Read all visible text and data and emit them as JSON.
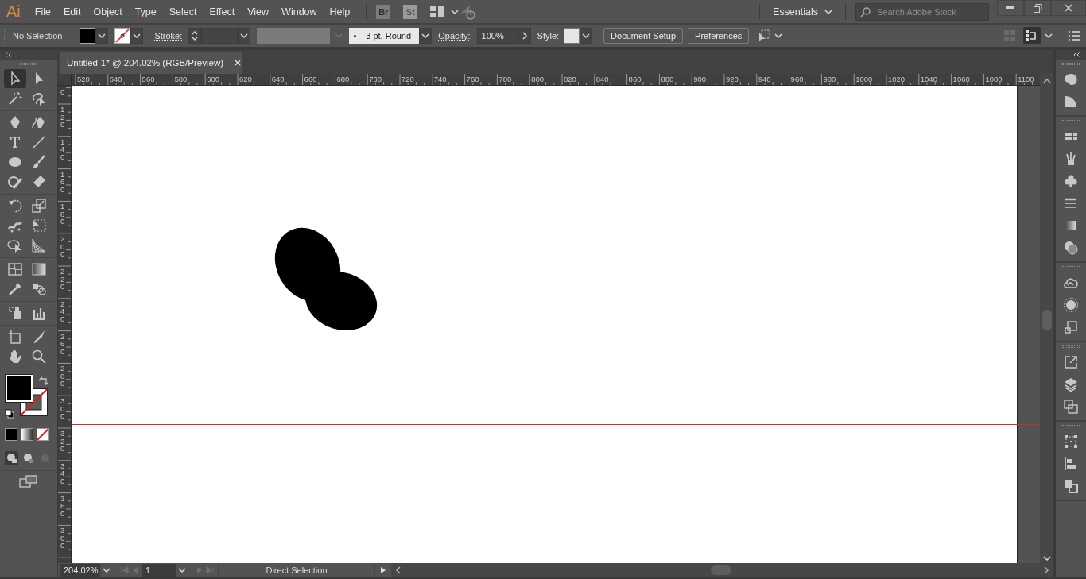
{
  "logo": "Ai",
  "menu": [
    "File",
    "Edit",
    "Object",
    "Type",
    "Select",
    "Effect",
    "View",
    "Window",
    "Help"
  ],
  "bridge": "Br",
  "stock": "St",
  "workspace": "Essentials",
  "search": {
    "placeholder": "Search Adobe Stock"
  },
  "control_bar": {
    "selection": "No Selection",
    "stroke_label": "Stroke:",
    "brush": "3 pt. Round",
    "opacity_label": "Opacity:",
    "opacity": "100%",
    "style_label": "Style:",
    "buttons": [
      "Document Setup",
      "Preferences"
    ]
  },
  "document_tab": {
    "title": "Untitled-1* @ 204.02% (RGB/Preview)"
  },
  "horizontal_ruler": [
    "520",
    "540",
    "560",
    "580",
    "600",
    "620",
    "640",
    "660",
    "680",
    "700",
    "720",
    "740",
    "760",
    "780",
    "800",
    "820",
    "840",
    "860",
    "880",
    "900",
    "920",
    "940",
    "960",
    "980",
    "1000",
    "1020",
    "1040",
    "1060",
    "1080",
    "1100"
  ],
  "vertical_ruler": [
    "0",
    "120",
    "140",
    "160",
    "180",
    "200",
    "220",
    "240",
    "260",
    "280",
    "300",
    "320",
    "340",
    "360",
    "380"
  ],
  "tool_groups": [
    {
      "tools": [
        {
          "kind": "selection",
          "selected": true
        },
        {
          "kind": "direct",
          "selected": false
        },
        {
          "kind": "wand",
          "selected": false
        },
        {
          "kind": "lasso",
          "selected": false
        }
      ]
    },
    {
      "tools": [
        {
          "kind": "pen",
          "selected": false
        },
        {
          "kind": "curvature",
          "selected": false
        },
        {
          "kind": "type",
          "selected": false
        },
        {
          "kind": "line",
          "selected": false
        },
        {
          "kind": "ellipse",
          "selected": false
        },
        {
          "kind": "brush",
          "selected": false
        },
        {
          "kind": "shaper",
          "selected": false
        },
        {
          "kind": "eraser",
          "selected": false
        }
      ]
    },
    {
      "tools": [
        {
          "kind": "rotate",
          "selected": false
        },
        {
          "kind": "scale",
          "selected": false
        },
        {
          "kind": "warp",
          "selected": false
        },
        {
          "kind": "freetransform",
          "selected": false
        },
        {
          "kind": "shapebuilder",
          "selected": false
        },
        {
          "kind": "perspective",
          "selected": false
        }
      ]
    },
    {
      "tools": [
        {
          "kind": "mesh",
          "selected": false
        },
        {
          "kind": "gradient",
          "selected": false
        },
        {
          "kind": "eyedropper",
          "selected": false
        },
        {
          "kind": "blend",
          "selected": false
        }
      ]
    },
    {
      "tools": [
        {
          "kind": "sprayer",
          "selected": false
        },
        {
          "kind": "graph",
          "selected": false
        }
      ]
    },
    {
      "tools": [
        {
          "kind": "artboard",
          "selected": false
        },
        {
          "kind": "knife",
          "selected": false
        },
        {
          "kind": "hand",
          "selected": false
        },
        {
          "kind": "zoom",
          "selected": false
        }
      ]
    }
  ],
  "panel_groups": [
    {
      "items": [
        {
          "kind": "color"
        },
        {
          "kind": "colorguide"
        }
      ]
    },
    {
      "items": [
        {
          "kind": "swatches"
        },
        {
          "kind": "brushes"
        },
        {
          "kind": "symbols"
        },
        {
          "kind": "stroke"
        },
        {
          "kind": "gradient"
        },
        {
          "kind": "transparency"
        }
      ]
    },
    {
      "items": [
        {
          "kind": "libraries"
        },
        {
          "kind": "appearance"
        },
        {
          "kind": "graphicstyles"
        }
      ]
    },
    {
      "items": [
        {
          "kind": "export"
        },
        {
          "kind": "layers"
        },
        {
          "kind": "artboards"
        }
      ]
    },
    {
      "items": [
        {
          "kind": "transform"
        },
        {
          "kind": "align"
        },
        {
          "kind": "pathfinder"
        }
      ]
    }
  ],
  "status_bar": {
    "zoom": "204.02%",
    "page": "1",
    "tool": "Direct Selection"
  }
}
